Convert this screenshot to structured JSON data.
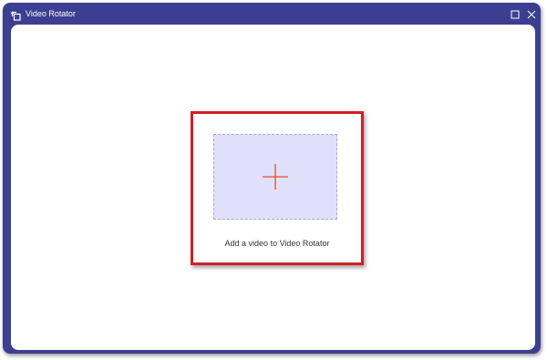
{
  "window": {
    "title": "Video Rotator",
    "icon": "rotate-app-icon",
    "controls": {
      "maximize_icon": "maximize-icon",
      "close_icon": "close-icon"
    }
  },
  "main": {
    "add_video": {
      "icon": "plus-icon",
      "label": "Add a video to Video Rotator"
    }
  },
  "colors": {
    "frame": "#3c3f91",
    "highlight": "#d11f26",
    "drop_zone": "#e0e0fb",
    "plus": "#e0502c"
  }
}
